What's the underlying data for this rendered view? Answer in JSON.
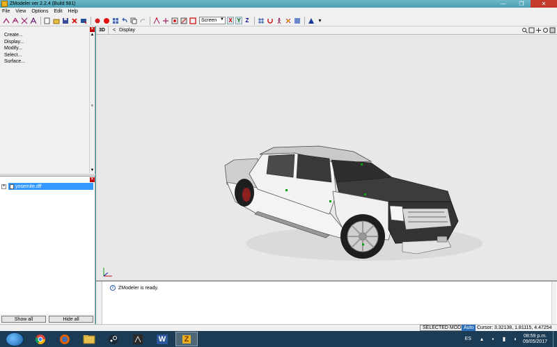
{
  "window": {
    "title": "ZModeler ver 2.2.4 (Build 981)",
    "minimize": "—",
    "maximize": "❐",
    "close": "✕"
  },
  "menu": [
    "File",
    "View",
    "Options",
    "Edit",
    "Help"
  ],
  "toolbar": {
    "mode_select": "Screen",
    "axis_x": "X",
    "axis_y": "Y",
    "axis_z": "Z"
  },
  "command_panel": {
    "items": [
      "Create...",
      "Display...",
      "Modify...",
      "Select...",
      "Surface..."
    ]
  },
  "scene_tree": {
    "items": [
      {
        "expander": "+",
        "label": "yosemite.dff"
      }
    ]
  },
  "left_buttons": {
    "show_all": "Show all",
    "hide_all": "Hide all"
  },
  "viewport": {
    "view_label": "3D",
    "display_label": "Display",
    "model": "yosemite.dff vehicle"
  },
  "console": {
    "messages": [
      "ZModeler is ready."
    ]
  },
  "statusbar": {
    "mode": "SELECTED MODE",
    "auto": "Auto",
    "cursor": "Cursor: 3.32138, 1.81115, 4.47254"
  },
  "taskbar": {
    "apps": [
      "chrome",
      "firefox",
      "file-explorer",
      "steam",
      "unreal",
      "word",
      "zmodeler"
    ],
    "word_label": "W",
    "zmodeler_label": "Z",
    "lang": "ES",
    "time": "08:59 p.m.",
    "date": "09/05/2017"
  },
  "colors": {
    "taskbar": "#1c3b54",
    "titlebar": "#5aaabe",
    "selection": "#3399ff",
    "close": "#c43b2e"
  }
}
